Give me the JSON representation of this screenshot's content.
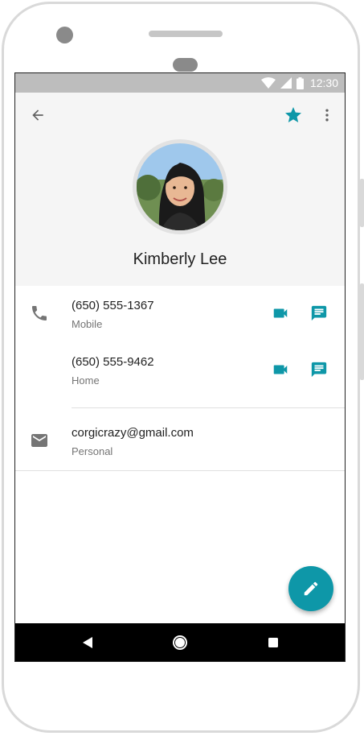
{
  "status_bar": {
    "time": "12:30",
    "icons": [
      "wifi-icon",
      "signal-icon",
      "battery-icon"
    ]
  },
  "toolbar": {
    "back_icon": "arrow-back-icon",
    "favorite_icon": "star-icon",
    "more_icon": "more-vert-icon"
  },
  "contact": {
    "name": "Kimberly Lee"
  },
  "phones": [
    {
      "number": "(650) 555-1367",
      "label": "Mobile"
    },
    {
      "number": "(650) 555-9462",
      "label": "Home"
    }
  ],
  "emails": [
    {
      "address": "corgicrazy@gmail.com",
      "label": "Personal"
    }
  ],
  "fab": {
    "icon": "edit-icon"
  },
  "nav_bar": {
    "icons": [
      "back-triangle-icon",
      "home-circle-icon",
      "recents-square-icon"
    ]
  },
  "colors": {
    "accent": "#0e97a8",
    "header_bg": "#f5f5f5",
    "status_bar": "#bdbdbd",
    "primary_text": "#212121",
    "secondary_text": "#757575"
  }
}
